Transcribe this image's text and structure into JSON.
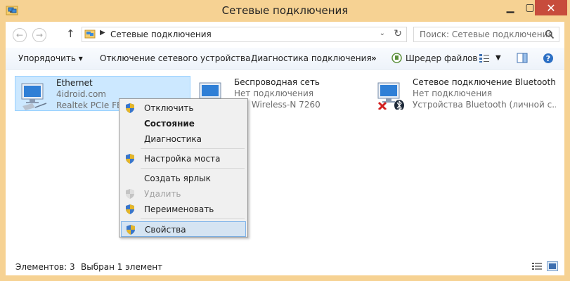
{
  "window": {
    "title": "Сетевые подключения"
  },
  "address": {
    "path": "Сетевые подключения"
  },
  "search": {
    "placeholder": "Поиск: Сетевые подключения"
  },
  "toolbar": {
    "organize": "Упорядочить ▾",
    "disable_device": "Отключение сетевого устройства",
    "diagnose": "Диагностика подключения",
    "overflow": "»",
    "shredder": "Шредер файлов"
  },
  "connections": [
    {
      "name": "Ethernet",
      "status": "4idroid.com",
      "device": "Realtek PCIe FE F"
    },
    {
      "name": "Беспроводная сеть",
      "status": "Нет подключения",
      "device": "l(R) Wireless-N 7260"
    },
    {
      "name": "Сетевое подключение Bluetooth",
      "status": "Нет подключения",
      "device": "Устройства Bluetooth (личной с..."
    }
  ],
  "context_menu": [
    {
      "label": "Отключить"
    },
    {
      "label": "Состояние"
    },
    {
      "label": "Диагностика"
    },
    {
      "label": "Настройка моста"
    },
    {
      "label": "Создать ярлык"
    },
    {
      "label": "Удалить"
    },
    {
      "label": "Переименовать"
    },
    {
      "label": "Свойства"
    }
  ],
  "status": {
    "count": "Элементов: 3",
    "selected": "Выбран 1 элемент"
  },
  "colors": {
    "titlebar": "#f6d293",
    "close": "#c74c3c",
    "selection": "#cce8ff",
    "hover": "#d5e4f2"
  }
}
